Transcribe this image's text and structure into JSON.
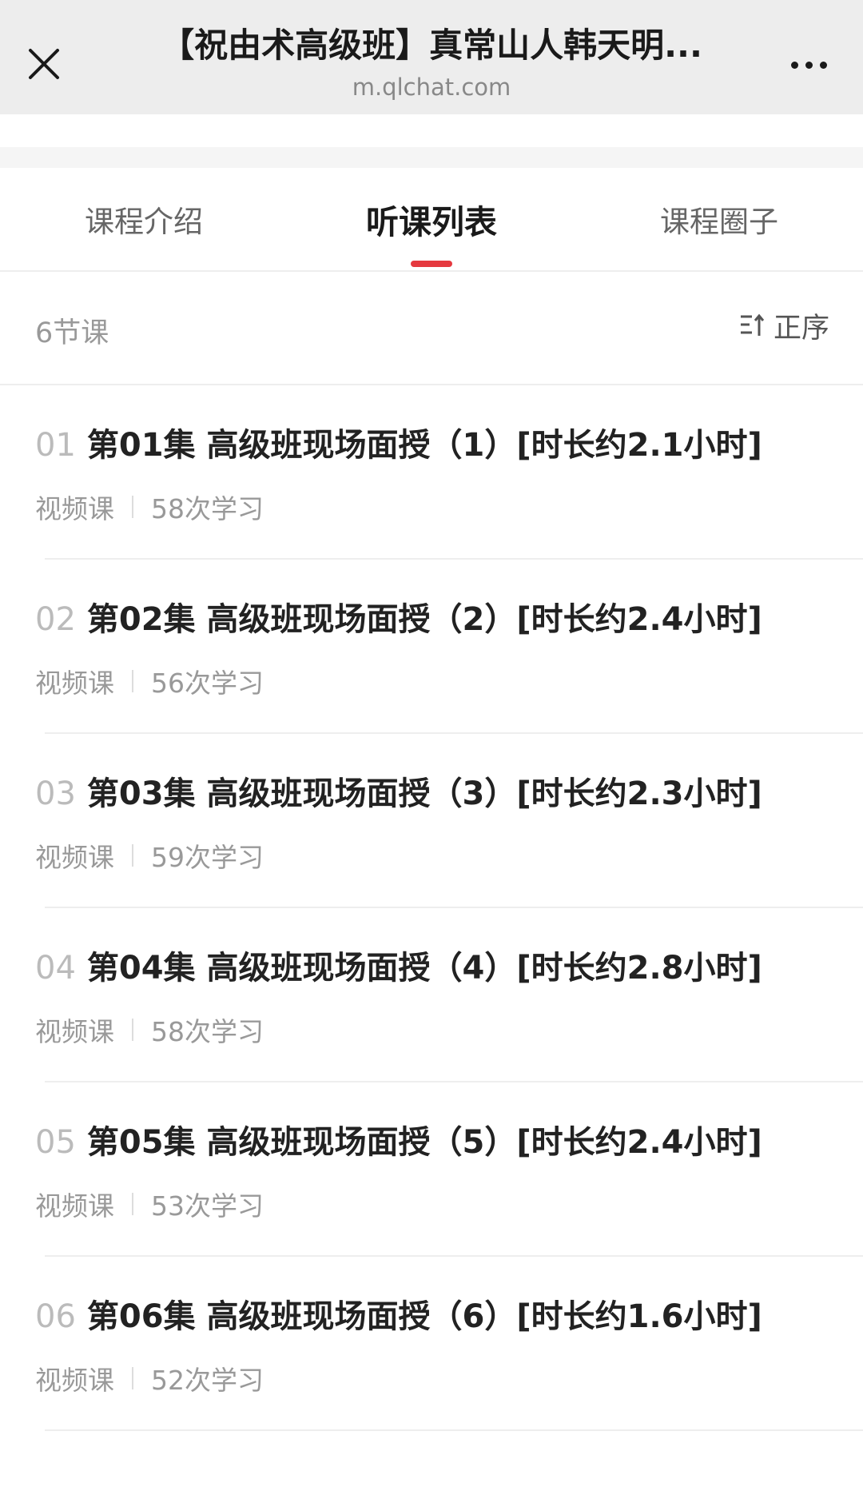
{
  "header": {
    "title": "【祝由术高级班】真常山人韩天明...",
    "domain": "m.qlchat.com",
    "close_icon": "close-icon",
    "more_icon": "more-icon"
  },
  "tabs": [
    {
      "label": "课程介绍"
    },
    {
      "label": "听课列表"
    },
    {
      "label": "课程圈子"
    }
  ],
  "active_tab": 1,
  "list_header": {
    "count_label": "6节课",
    "sort_label": "正序",
    "sort_icon": "sort-icon"
  },
  "lessons": [
    {
      "num": "01",
      "title": "第01集 高级班现场面授（1）[时长约2.1小时]",
      "type": "视频课",
      "views": "58次学习"
    },
    {
      "num": "02",
      "title": "第02集 高级班现场面授（2）[时长约2.4小时]",
      "type": "视频课",
      "views": "56次学习"
    },
    {
      "num": "03",
      "title": "第03集 高级班现场面授（3）[时长约2.3小时]",
      "type": "视频课",
      "views": "59次学习"
    },
    {
      "num": "04",
      "title": "第04集 高级班现场面授（4）[时长约2.8小时]",
      "type": "视频课",
      "views": "58次学习"
    },
    {
      "num": "05",
      "title": "第05集 高级班现场面授（5）[时长约2.4小时]",
      "type": "视频课",
      "views": "53次学习"
    },
    {
      "num": "06",
      "title": "第06集 高级班现场面授（6）[时长约1.6小时]",
      "type": "视频课",
      "views": "52次学习"
    }
  ],
  "colors": {
    "accent": "#e5393f",
    "topbar_bg": "#ededed"
  }
}
